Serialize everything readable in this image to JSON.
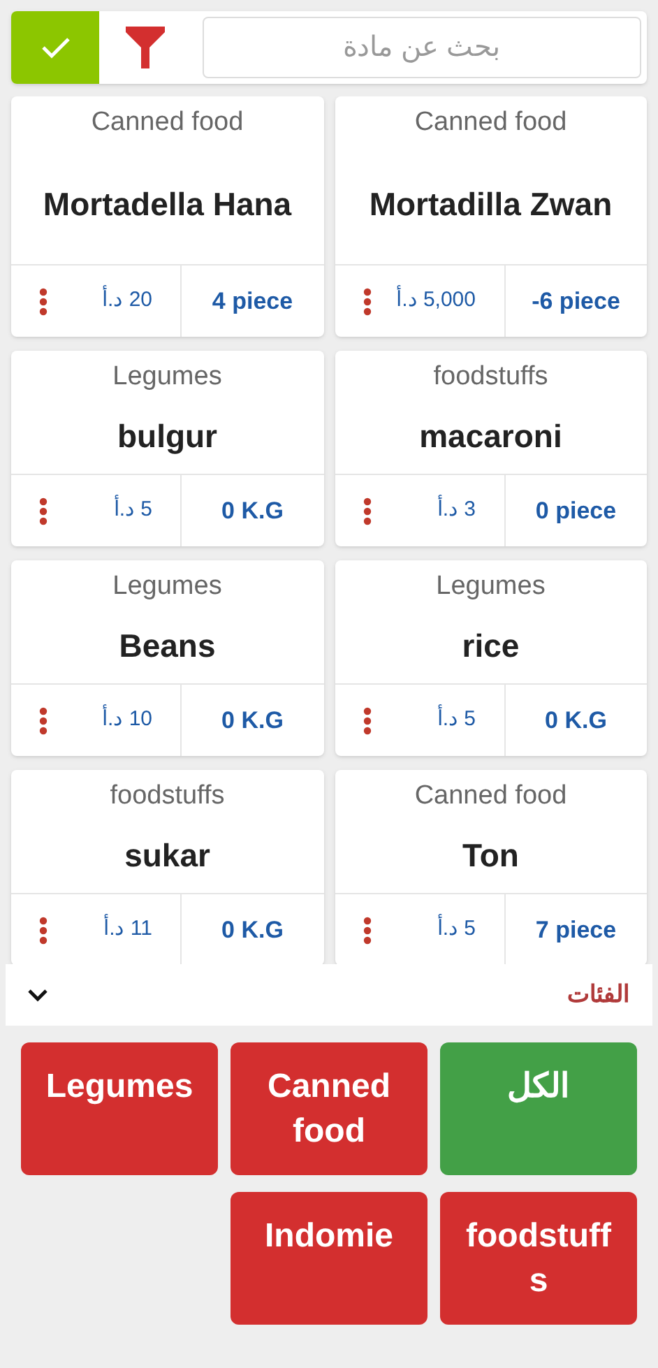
{
  "toolbar": {
    "confirm_selected": true,
    "search": {
      "placeholder": "بحث عن مادة"
    }
  },
  "items": [
    {
      "category": "Canned food",
      "name": "Mortadella Hana",
      "price": "20 د.أ",
      "quantity": "4 piece"
    },
    {
      "category": "Canned food",
      "name": "Mortadilla Zwan",
      "price": "5,000 د.أ",
      "quantity": "-6 piece"
    },
    {
      "category": "Legumes",
      "name": "bulgur",
      "price": "5 د.أ",
      "quantity": "0 K.G"
    },
    {
      "category": "foodstuffs",
      "name": "macaroni",
      "price": "3 د.أ",
      "quantity": "0 piece"
    },
    {
      "category": "Legumes",
      "name": "Beans",
      "price": "10 د.أ",
      "quantity": "0 K.G"
    },
    {
      "category": "Legumes",
      "name": "rice",
      "price": "5 د.أ",
      "quantity": "0 K.G"
    },
    {
      "category": "foodstuffs",
      "name": "sukar",
      "price": "11 د.أ",
      "quantity": "0 K.G"
    },
    {
      "category": "Canned food",
      "name": "Ton",
      "price": "5 د.أ",
      "quantity": "7 piece"
    }
  ],
  "categories_panel": {
    "title": "الفئات",
    "expanded": true,
    "buttons": [
      {
        "label": "Legumes",
        "selected": false
      },
      {
        "label": "Canned food",
        "selected": false
      },
      {
        "label": "الكل",
        "selected": true
      },
      {
        "label": "Indomie",
        "selected": false
      },
      {
        "label": "foodstuffs",
        "selected": false
      }
    ]
  }
}
